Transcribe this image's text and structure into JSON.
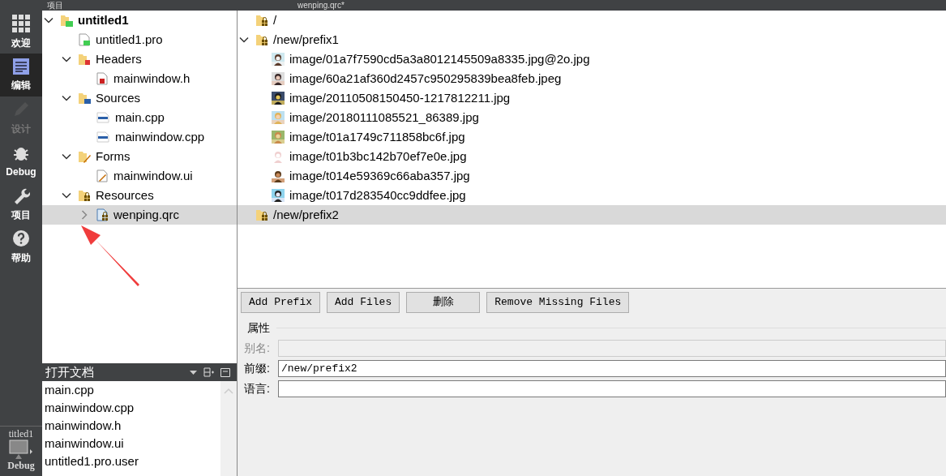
{
  "toolbar": {
    "pane_title": "项目",
    "editor_file": "wenping.qrc*"
  },
  "mode_bar": {
    "items": [
      {
        "label": "欢迎",
        "kind": "welcome",
        "selected": false,
        "disabled": false
      },
      {
        "label": "编辑",
        "kind": "edit",
        "selected": true,
        "disabled": false
      },
      {
        "label": "设计",
        "kind": "design",
        "selected": false,
        "disabled": true
      },
      {
        "label": "Debug",
        "kind": "debug",
        "selected": false,
        "disabled": false
      },
      {
        "label": "项目",
        "kind": "projects",
        "selected": false,
        "disabled": false
      },
      {
        "label": "帮助",
        "kind": "help",
        "selected": false,
        "disabled": false
      }
    ],
    "kit": {
      "project": "titled1",
      "build": "Debug"
    }
  },
  "project_tree": [
    {
      "label": "untitled1",
      "kind": "project",
      "expanded": true,
      "selected": false,
      "children": [
        {
          "label": "untitled1.pro",
          "kind": "pro",
          "selected": false
        },
        {
          "label": "Headers",
          "kind": "header-folder",
          "expanded": true,
          "selected": false,
          "children": [
            {
              "label": "mainwindow.h",
              "kind": "header",
              "selected": false
            }
          ]
        },
        {
          "label": "Sources",
          "kind": "source-folder",
          "expanded": true,
          "selected": false,
          "children": [
            {
              "label": "main.cpp",
              "kind": "source",
              "selected": false
            },
            {
              "label": "mainwindow.cpp",
              "kind": "source",
              "selected": false
            }
          ]
        },
        {
          "label": "Forms",
          "kind": "form-folder",
          "expanded": true,
          "selected": false,
          "children": [
            {
              "label": "mainwindow.ui",
              "kind": "form",
              "selected": false
            }
          ]
        },
        {
          "label": "Resources",
          "kind": "resource-folder",
          "expanded": true,
          "selected": false,
          "children": [
            {
              "label": "wenping.qrc",
              "kind": "qrc",
              "expanded": false,
              "selected": true
            }
          ]
        }
      ]
    }
  ],
  "open_documents": {
    "title": "打开文档",
    "items": [
      "main.cpp",
      "mainwindow.cpp",
      "mainwindow.h",
      "mainwindow.ui",
      "untitled1.pro.user"
    ]
  },
  "resource_tree": [
    {
      "label": "/",
      "kind": "prefix",
      "selected": false
    },
    {
      "label": "/new/prefix1",
      "kind": "prefix",
      "expanded": true,
      "selected": false,
      "children": [
        {
          "label": "image/01a7f7590cd5a3a8012145509a8335.jpg@2o.jpg",
          "selected": false
        },
        {
          "label": "image/60a21af360d2457c950295839bea8feb.jpeg",
          "selected": false
        },
        {
          "label": "image/20110508150450-1217812211.jpg",
          "selected": false
        },
        {
          "label": "image/20180111085521_86389.jpg",
          "selected": false
        },
        {
          "label": "image/t01a1749c711858bc6f.jpg",
          "selected": false
        },
        {
          "label": "image/t01b3bc142b70ef7e0e.jpg",
          "selected": false
        },
        {
          "label": "image/t014e59369c66aba357.jpg",
          "selected": false
        },
        {
          "label": "image/t017d283540cc9ddfee.jpg",
          "selected": false
        }
      ]
    },
    {
      "label": "/new/prefix2",
      "kind": "prefix",
      "selected": true
    }
  ],
  "buttons": [
    "Add Prefix",
    "Add Files",
    "删除",
    "Remove Missing Files"
  ],
  "properties": {
    "title": "属性",
    "fields": [
      {
        "label": "别名:",
        "disabled": true
      },
      {
        "label": "前缀:",
        "value": "/new/prefix2",
        "disabled": false
      },
      {
        "label": "语言:",
        "disabled": false
      }
    ]
  }
}
